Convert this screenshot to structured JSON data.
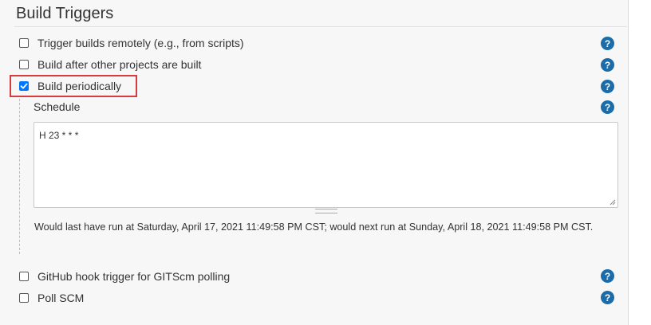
{
  "section": {
    "title": "Build Triggers"
  },
  "triggers": [
    {
      "label": "Trigger builds remotely (e.g., from scripts)",
      "checked": false
    },
    {
      "label": "Build after other projects are built",
      "checked": false
    },
    {
      "label": "Build periodically",
      "checked": true
    },
    {
      "label": "GitHub hook trigger for GITScm polling",
      "checked": false
    },
    {
      "label": "Poll SCM",
      "checked": false
    }
  ],
  "schedule": {
    "label": "Schedule",
    "value": "H 23 * * *",
    "info": "Would last have run at Saturday, April 17, 2021 11:49:58 PM CST; would next run at Sunday, April 18, 2021 11:49:58 PM CST."
  },
  "colors": {
    "help_icon": "#1b6ca8",
    "checkbox_checked": "#0075ff",
    "highlight_border": "#d83b3b"
  },
  "icons": {
    "help": "question-circle-icon",
    "check": "checkmark-icon"
  }
}
